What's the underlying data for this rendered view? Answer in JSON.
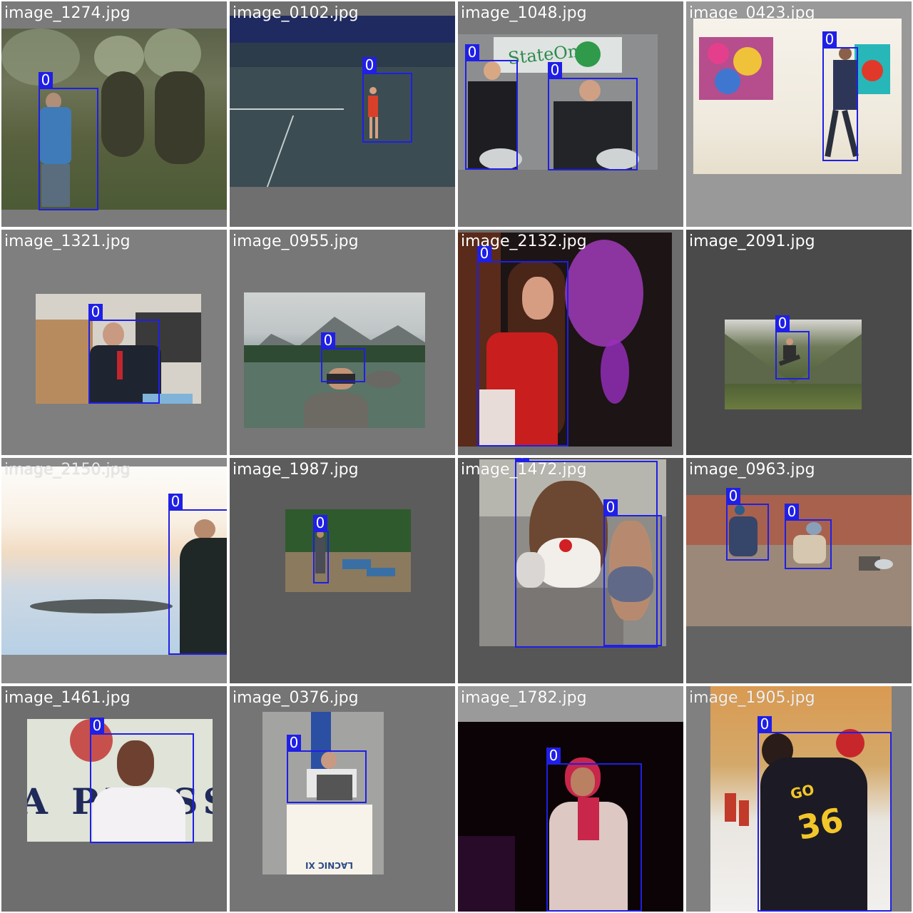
{
  "tiles": [
    {
      "filename": "image_1274.jpg",
      "background": "#7b7b7b",
      "labels": [
        "0"
      ],
      "photo_desc": "woman in blue jacket among frailejon plants"
    },
    {
      "filename": "image_0102.jpg",
      "background": "#6f6f6f",
      "labels": [
        "0"
      ],
      "photo_desc": "tennis player serving on court"
    },
    {
      "filename": "image_1048.jpg",
      "background": "#7a7a7a",
      "labels": [
        "0",
        "0"
      ],
      "photo_desc": "two men in suits at an exhibition stand",
      "sign_text": "StateOne"
    },
    {
      "filename": "image_0423.jpg",
      "background": "#999999",
      "labels": [
        "0"
      ],
      "photo_desc": "person walking in art gallery"
    },
    {
      "filename": "image_1321.jpg",
      "background": "#7f7f7f",
      "labels": [
        "0"
      ],
      "photo_desc": "man speaking at a podium microphone"
    },
    {
      "filename": "image_0955.jpg",
      "background": "#777777",
      "labels": [
        "0"
      ],
      "photo_desc": "person crouching on a rock in a mountain lake"
    },
    {
      "filename": "image_2132.jpg",
      "background": "#6d6d6d",
      "labels": [
        "0"
      ],
      "photo_desc": "woman in red shirt with purple bokeh lights"
    },
    {
      "filename": "image_2091.jpg",
      "background": "#4a4a4a",
      "labels": [
        "0"
      ],
      "photo_desc": "person jumping in a green mountain valley"
    },
    {
      "filename": "image_2150.jpg",
      "background": "#8a8a8a",
      "labels": [
        "0"
      ],
      "photo_desc": "person stretching by a sunrise seascape"
    },
    {
      "filename": "image_1987.jpg",
      "background": "#5c5c5c",
      "labels": [
        "0"
      ],
      "photo_desc": "person standing near picnic tables under trees"
    },
    {
      "filename": "image_1472.jpg",
      "background": "#565656",
      "labels": [
        "0",
        "0"
      ],
      "photo_desc": "man with clown mask and woman with face mask"
    },
    {
      "filename": "image_0963.jpg",
      "background": "#636363",
      "labels": [
        "0",
        "0"
      ],
      "photo_desc": "two people crouching near a brick wall"
    },
    {
      "filename": "image_1461.jpg",
      "background": "#6e6e6e",
      "labels": [
        "0"
      ],
      "photo_desc": "smiling woman in striped shirt",
      "sign_text": "A PRESS"
    },
    {
      "filename": "image_0376.jpg",
      "background": "#757575",
      "labels": [
        "0"
      ],
      "photo_desc": "speaker at a lectern with a laptop",
      "sign_text": "LACNIC XI"
    },
    {
      "filename": "image_1782.jpg",
      "background": "#9a9a9a",
      "labels": [
        "0"
      ],
      "photo_desc": "woman in pink headscarf speaking on stage"
    },
    {
      "filename": "image_1905.jpg",
      "background": "#808080",
      "labels": [
        "0"
      ],
      "photo_desc": "handball player in jersey number 36 throwing",
      "jersey_text": "GO",
      "jersey_number": "36"
    }
  ]
}
